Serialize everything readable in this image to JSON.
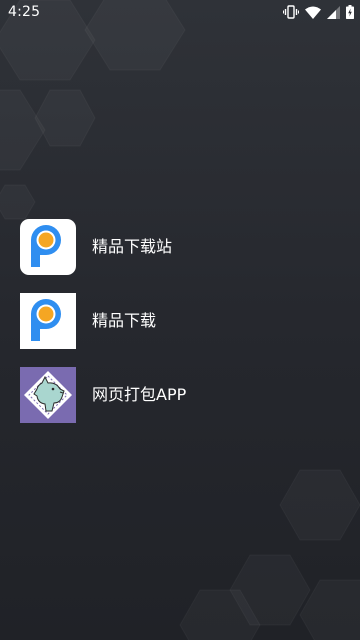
{
  "status_bar": {
    "time": "4:25",
    "icons": [
      "vibrate-icon",
      "wifi-icon",
      "signal-icon",
      "battery-charging-icon"
    ]
  },
  "apps": [
    {
      "label": "精品下载站",
      "icon": "p-logo-icon"
    },
    {
      "label": "精品下载",
      "icon": "p-logo-icon"
    },
    {
      "label": "网页打包APP",
      "icon": "dog-puzzle-icon"
    }
  ],
  "colors": {
    "background": "#2a2c32",
    "p_logo_blue": "#2f8ef0",
    "p_logo_orange": "#f5a623",
    "dog_purple": "#7a6bb0",
    "text": "#ffffff"
  }
}
